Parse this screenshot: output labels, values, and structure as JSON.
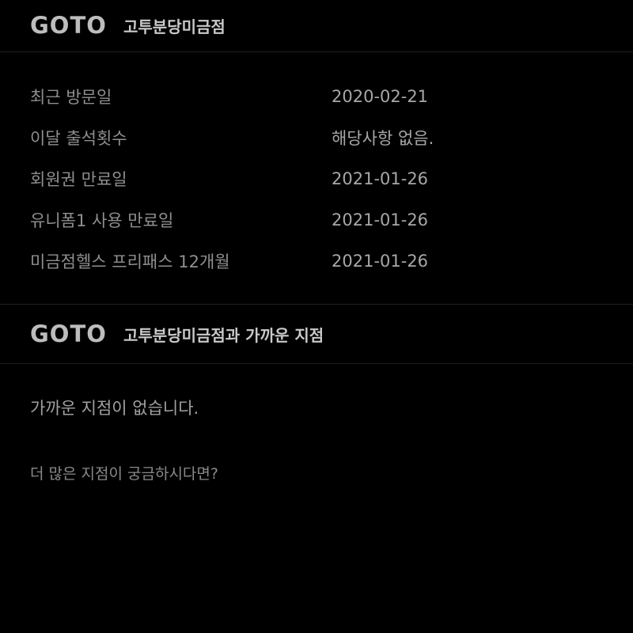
{
  "header": {
    "logo_text": "GOTO",
    "branch_name": "고투분당미금점"
  },
  "info": {
    "rows": [
      {
        "label": "최근 방문일",
        "value": "2020-02-21"
      },
      {
        "label": "이달 출석횟수",
        "value": "해당사항 없음."
      },
      {
        "label": "회원권 만료일",
        "value": "2021-01-26"
      },
      {
        "label": "유니폼1 사용 만료일",
        "value": "2021-01-26"
      },
      {
        "label": "미금점헬스 프리패스 12개월",
        "value": "2021-01-26"
      }
    ]
  },
  "nearby": {
    "logo_text": "GOTO",
    "title": "고투분당미금점과 가까운 지점",
    "empty_message": "가까운 지점이 없습니다.",
    "more_link": "더 많은 지점이 궁금하시다면?"
  }
}
